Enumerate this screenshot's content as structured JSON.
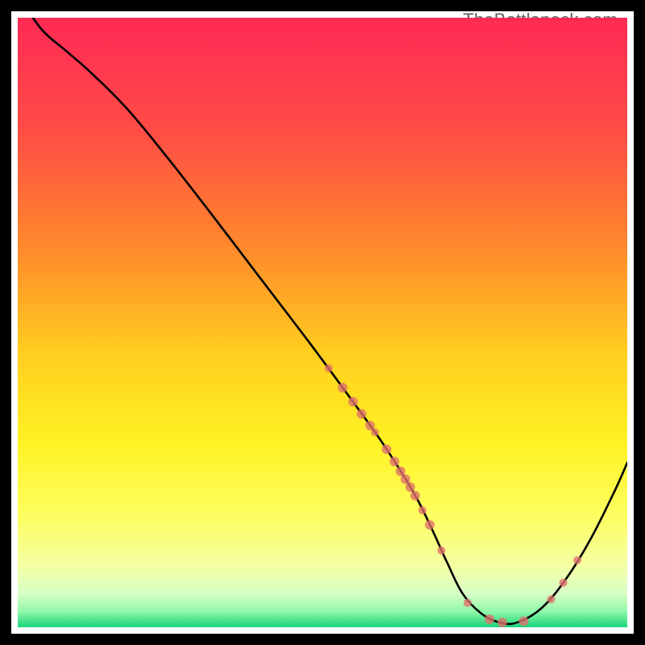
{
  "attribution": "TheBottleneck.com",
  "chart_data": {
    "type": "line",
    "title": "",
    "xlabel": "",
    "ylabel": "",
    "xlim": [
      0,
      100
    ],
    "ylim": [
      0,
      100
    ],
    "background_gradient": {
      "stops": [
        {
          "offset": 0.0,
          "color": "#ff2a55"
        },
        {
          "offset": 0.18,
          "color": "#ff4b46"
        },
        {
          "offset": 0.38,
          "color": "#ff8a2b"
        },
        {
          "offset": 0.55,
          "color": "#ffce1f"
        },
        {
          "offset": 0.7,
          "color": "#fff324"
        },
        {
          "offset": 0.82,
          "color": "#fdfe62"
        },
        {
          "offset": 0.9,
          "color": "#f4ffa4"
        },
        {
          "offset": 0.945,
          "color": "#d8ffc6"
        },
        {
          "offset": 0.975,
          "color": "#8cf7a8"
        },
        {
          "offset": 1.0,
          "color": "#18d47a"
        }
      ]
    },
    "series": [
      {
        "name": "curve",
        "x": [
          0.5,
          4,
          8,
          12,
          18,
          25,
          32,
          40,
          48,
          55,
          60,
          65,
          68,
          70.5,
          73,
          76,
          79,
          82,
          86,
          90,
          94,
          98,
          100
        ],
        "y": [
          103,
          98,
          94.5,
          91,
          85,
          76.5,
          67.5,
          57,
          46.5,
          37,
          30,
          22,
          16,
          10.5,
          5.5,
          2.3,
          0.8,
          0.8,
          3.2,
          8,
          14.5,
          22.5,
          27
        ]
      }
    ],
    "markers": [
      {
        "x": 51.0,
        "y": 42.5,
        "r": 5
      },
      {
        "x": 53.3,
        "y": 39.3,
        "r": 6
      },
      {
        "x": 55.0,
        "y": 37.0,
        "r": 6
      },
      {
        "x": 56.4,
        "y": 35.0,
        "r": 6
      },
      {
        "x": 57.8,
        "y": 33.1,
        "r": 6
      },
      {
        "x": 58.6,
        "y": 32.0,
        "r": 5
      },
      {
        "x": 60.5,
        "y": 29.2,
        "r": 6
      },
      {
        "x": 61.8,
        "y": 27.2,
        "r": 6
      },
      {
        "x": 62.8,
        "y": 25.6,
        "r": 6
      },
      {
        "x": 63.6,
        "y": 24.3,
        "r": 6
      },
      {
        "x": 64.4,
        "y": 23.0,
        "r": 6
      },
      {
        "x": 65.2,
        "y": 21.6,
        "r": 6
      },
      {
        "x": 66.4,
        "y": 19.2,
        "r": 5
      },
      {
        "x": 67.6,
        "y": 16.8,
        "r": 6
      },
      {
        "x": 69.5,
        "y": 12.6,
        "r": 5
      },
      {
        "x": 73.8,
        "y": 4.0,
        "r": 5
      },
      {
        "x": 77.4,
        "y": 1.3,
        "r": 6
      },
      {
        "x": 79.5,
        "y": 0.8,
        "r": 6
      },
      {
        "x": 83.0,
        "y": 1.0,
        "r": 6
      },
      {
        "x": 87.5,
        "y": 4.6,
        "r": 5
      },
      {
        "x": 89.5,
        "y": 7.3,
        "r": 5
      },
      {
        "x": 91.8,
        "y": 11.0,
        "r": 5
      }
    ],
    "style": {
      "curve_stroke": "#000000",
      "curve_width": 2.6,
      "marker_fill": "#e0716c",
      "marker_fill_opacity": 0.78,
      "marker_stroke": "none"
    }
  }
}
